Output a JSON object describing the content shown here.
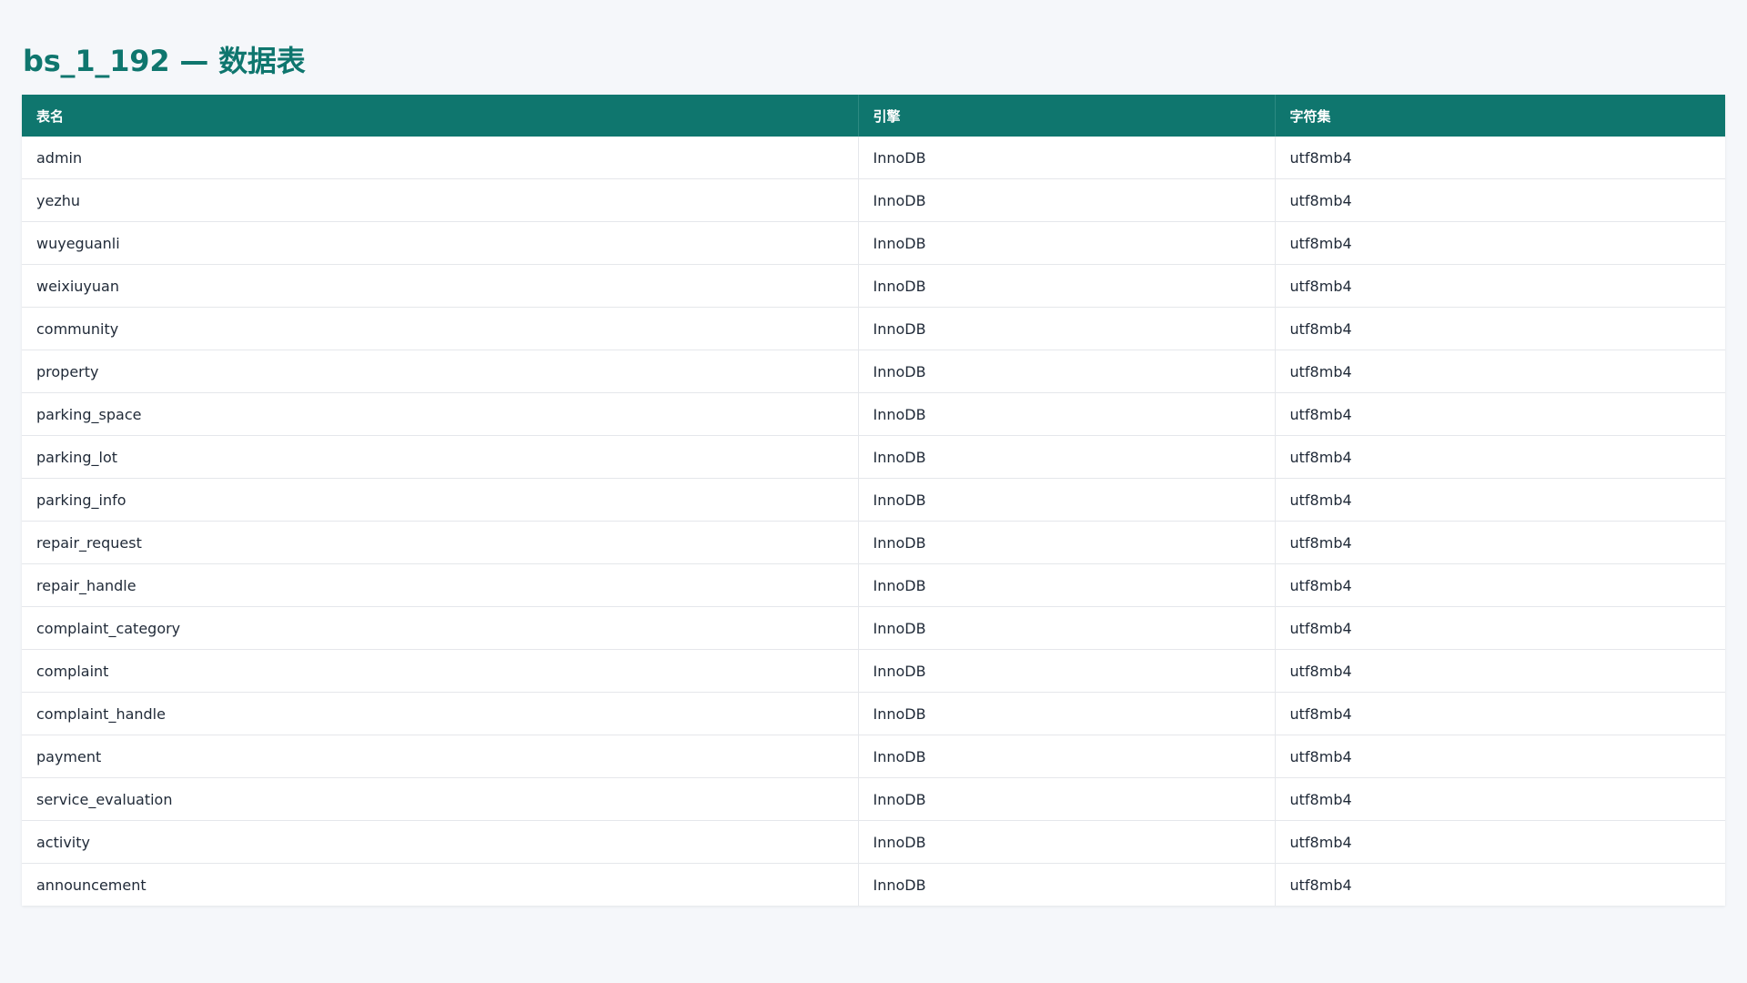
{
  "page": {
    "title": "bs_1_192 — 数据表"
  },
  "table": {
    "columns": [
      "表名",
      "引擎",
      "字符集"
    ],
    "rows": [
      [
        "admin",
        "InnoDB",
        "utf8mb4"
      ],
      [
        "yezhu",
        "InnoDB",
        "utf8mb4"
      ],
      [
        "wuyeguanli",
        "InnoDB",
        "utf8mb4"
      ],
      [
        "weixiuyuan",
        "InnoDB",
        "utf8mb4"
      ],
      [
        "community",
        "InnoDB",
        "utf8mb4"
      ],
      [
        "property",
        "InnoDB",
        "utf8mb4"
      ],
      [
        "parking_space",
        "InnoDB",
        "utf8mb4"
      ],
      [
        "parking_lot",
        "InnoDB",
        "utf8mb4"
      ],
      [
        "parking_info",
        "InnoDB",
        "utf8mb4"
      ],
      [
        "repair_request",
        "InnoDB",
        "utf8mb4"
      ],
      [
        "repair_handle",
        "InnoDB",
        "utf8mb4"
      ],
      [
        "complaint_category",
        "InnoDB",
        "utf8mb4"
      ],
      [
        "complaint",
        "InnoDB",
        "utf8mb4"
      ],
      [
        "complaint_handle",
        "InnoDB",
        "utf8mb4"
      ],
      [
        "payment",
        "InnoDB",
        "utf8mb4"
      ],
      [
        "service_evaluation",
        "InnoDB",
        "utf8mb4"
      ],
      [
        "activity",
        "InnoDB",
        "utf8mb4"
      ],
      [
        "announcement",
        "InnoDB",
        "utf8mb4"
      ]
    ]
  },
  "colors": {
    "accent": "#0f766e",
    "background": "#f5f7fa",
    "row_border": "#e5e7eb"
  }
}
